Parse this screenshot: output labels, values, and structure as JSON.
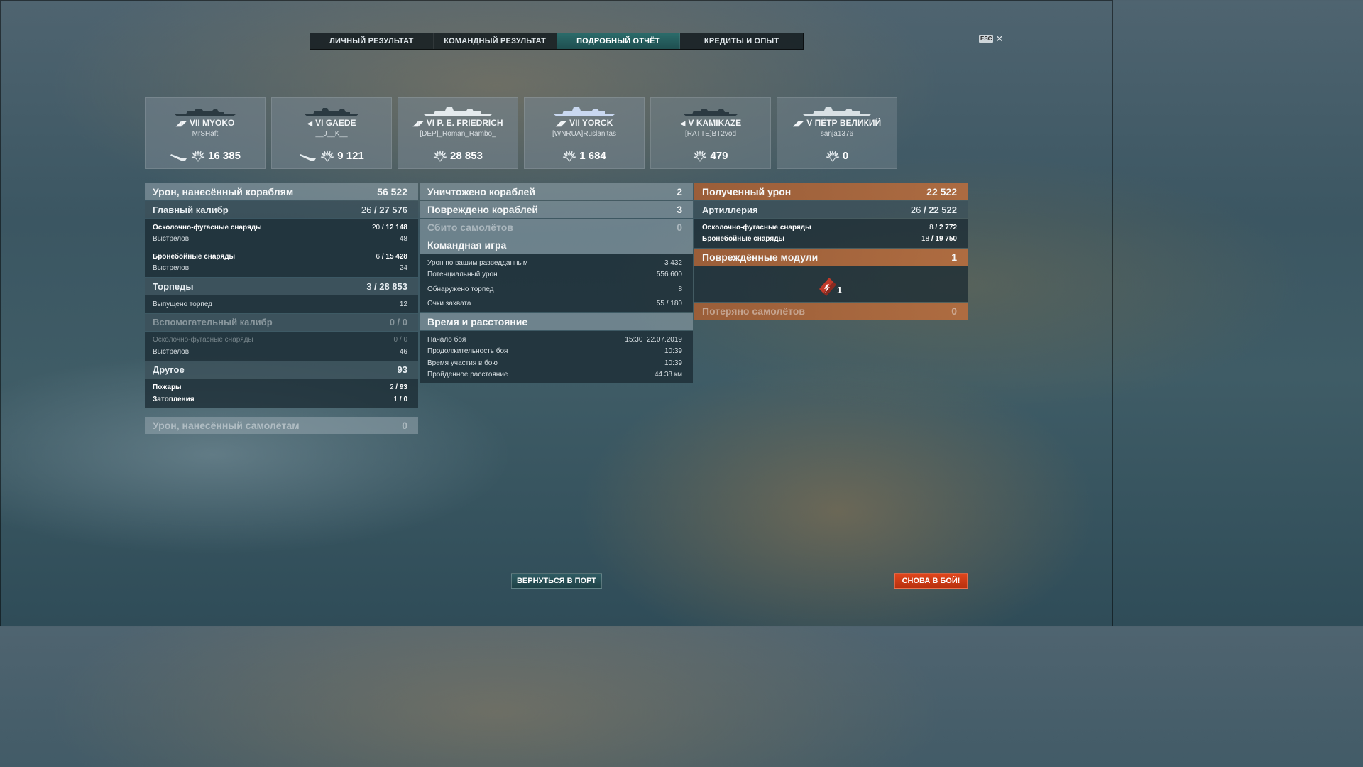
{
  "tabs": [
    {
      "label": "ЛИЧНЫЙ РЕЗУЛЬТАТ"
    },
    {
      "label": "КОМАНДНЫЙ РЕЗУЛЬТАТ"
    },
    {
      "label": "ПОДРОБНЫЙ ОТЧЁТ"
    },
    {
      "label": "КРЕДИТЫ И ОПЫТ"
    }
  ],
  "active_tab": "ПОДРОБНЫЙ ОТЧЁТ",
  "esc": {
    "key": "ESC",
    "close": "✕"
  },
  "cards": [
    {
      "tier": "VII",
      "name": "MYŌKŌ",
      "player": "MrSHaft",
      "damage": "16 385",
      "has_torpedo_icon": true
    },
    {
      "tier": "VI",
      "name": "GAEDE",
      "player": "__J__K__",
      "damage": "9 121",
      "has_torpedo_icon": true
    },
    {
      "tier": "VI",
      "name": "P. E. FRIEDRICH",
      "player": "[DEP]_Roman_Rambo_",
      "damage": "28 853",
      "has_torpedo_icon": false
    },
    {
      "tier": "VII",
      "name": "YORCK",
      "player": "[WNRUA]Ruslanitas",
      "damage": "1 684",
      "has_torpedo_icon": false
    },
    {
      "tier": "V",
      "name": "KAMIKAZE",
      "player": "[RATTE]BT2vod",
      "damage": "479",
      "has_torpedo_icon": false
    },
    {
      "tier": "V",
      "name": "ПЁТР ВЕЛИКИЙ",
      "player": "sanja1376",
      "damage": "0",
      "has_torpedo_icon": false
    }
  ],
  "damage_dealt": {
    "title": "Урон, нанесённый кораблям",
    "value": "56 522",
    "main_battery": {
      "title": "Главный калибр",
      "hits": "26",
      "damage": "27 576",
      "he": {
        "label": "Осколочно-фугасные снаряды",
        "hits": "20",
        "damage": "12 148"
      },
      "he_shots": {
        "label": "Выстрелов",
        "value": "48"
      },
      "ap": {
        "label": "Бронебойные снаряды",
        "hits": "6",
        "damage": "15 428"
      },
      "ap_shots": {
        "label": "Выстрелов",
        "value": "24"
      }
    },
    "torpedoes": {
      "title": "Торпеды",
      "hits": "3",
      "damage": "28 853",
      "launched": {
        "label": "Выпущено торпед",
        "value": "12"
      }
    },
    "secondary": {
      "title": "Вспомогательный калибр",
      "hits": "0",
      "damage": "0",
      "he": {
        "label": "Осколочно-фугасные снаряды",
        "hits": "0",
        "damage": "0"
      },
      "shots": {
        "label": "Выстрелов",
        "value": "46"
      }
    },
    "other": {
      "title": "Другое",
      "value": "93",
      "fires": {
        "label": "Пожары",
        "hits": "2",
        "damage": "93"
      },
      "floods": {
        "label": "Затопления",
        "hits": "1",
        "damage": "0"
      }
    },
    "aircraft": {
      "title": "Урон, нанесённый самолётам",
      "value": "0"
    }
  },
  "battle": {
    "destroyed": {
      "label": "Уничтожено кораблей",
      "value": "2"
    },
    "damaged": {
      "label": "Повреждено кораблей",
      "value": "3"
    },
    "planes_shot": {
      "label": "Сбито самолётов",
      "value": "0"
    },
    "team_play": {
      "title": "Командная игра",
      "spotting": {
        "label": "Урон по вашим разведданным",
        "value": "3 432"
      },
      "potential": {
        "label": "Потенциальный урон",
        "value": "556 600"
      },
      "torp_spotted": {
        "label": "Обнаружено торпед",
        "value": "8"
      },
      "capture": {
        "label": "Очки захвата",
        "value": "55 / 180"
      }
    },
    "time": {
      "title": "Время и расстояние",
      "start": {
        "label": "Начало боя",
        "value": "15:30  22.07.2019"
      },
      "duration": {
        "label": "Продолжительность боя",
        "value": "10:39"
      },
      "participation": {
        "label": "Время участия в бою",
        "value": "10:39"
      },
      "distance": {
        "label": "Пройденное расстояние",
        "value": "44.38 км"
      }
    }
  },
  "received": {
    "title": "Полученный урон",
    "value": "22 522",
    "artillery": {
      "title": "Артиллерия",
      "hits": "26",
      "damage": "22 522",
      "he": {
        "label": "Осколочно-фугасные снаряды",
        "hits": "8",
        "damage": "2 772"
      },
      "ap": {
        "label": "Бронебойные снаряды",
        "hits": "18",
        "damage": "19 750"
      }
    },
    "modules": {
      "title": "Повреждённые модули",
      "value": "1",
      "icon_count": "1"
    },
    "planes_lost": {
      "title": "Потеряно самолётов",
      "value": "0"
    }
  },
  "buttons": {
    "port": "ВЕРНУТЬСЯ В ПОРТ",
    "battle": "СНОВА В БОЙ!"
  }
}
